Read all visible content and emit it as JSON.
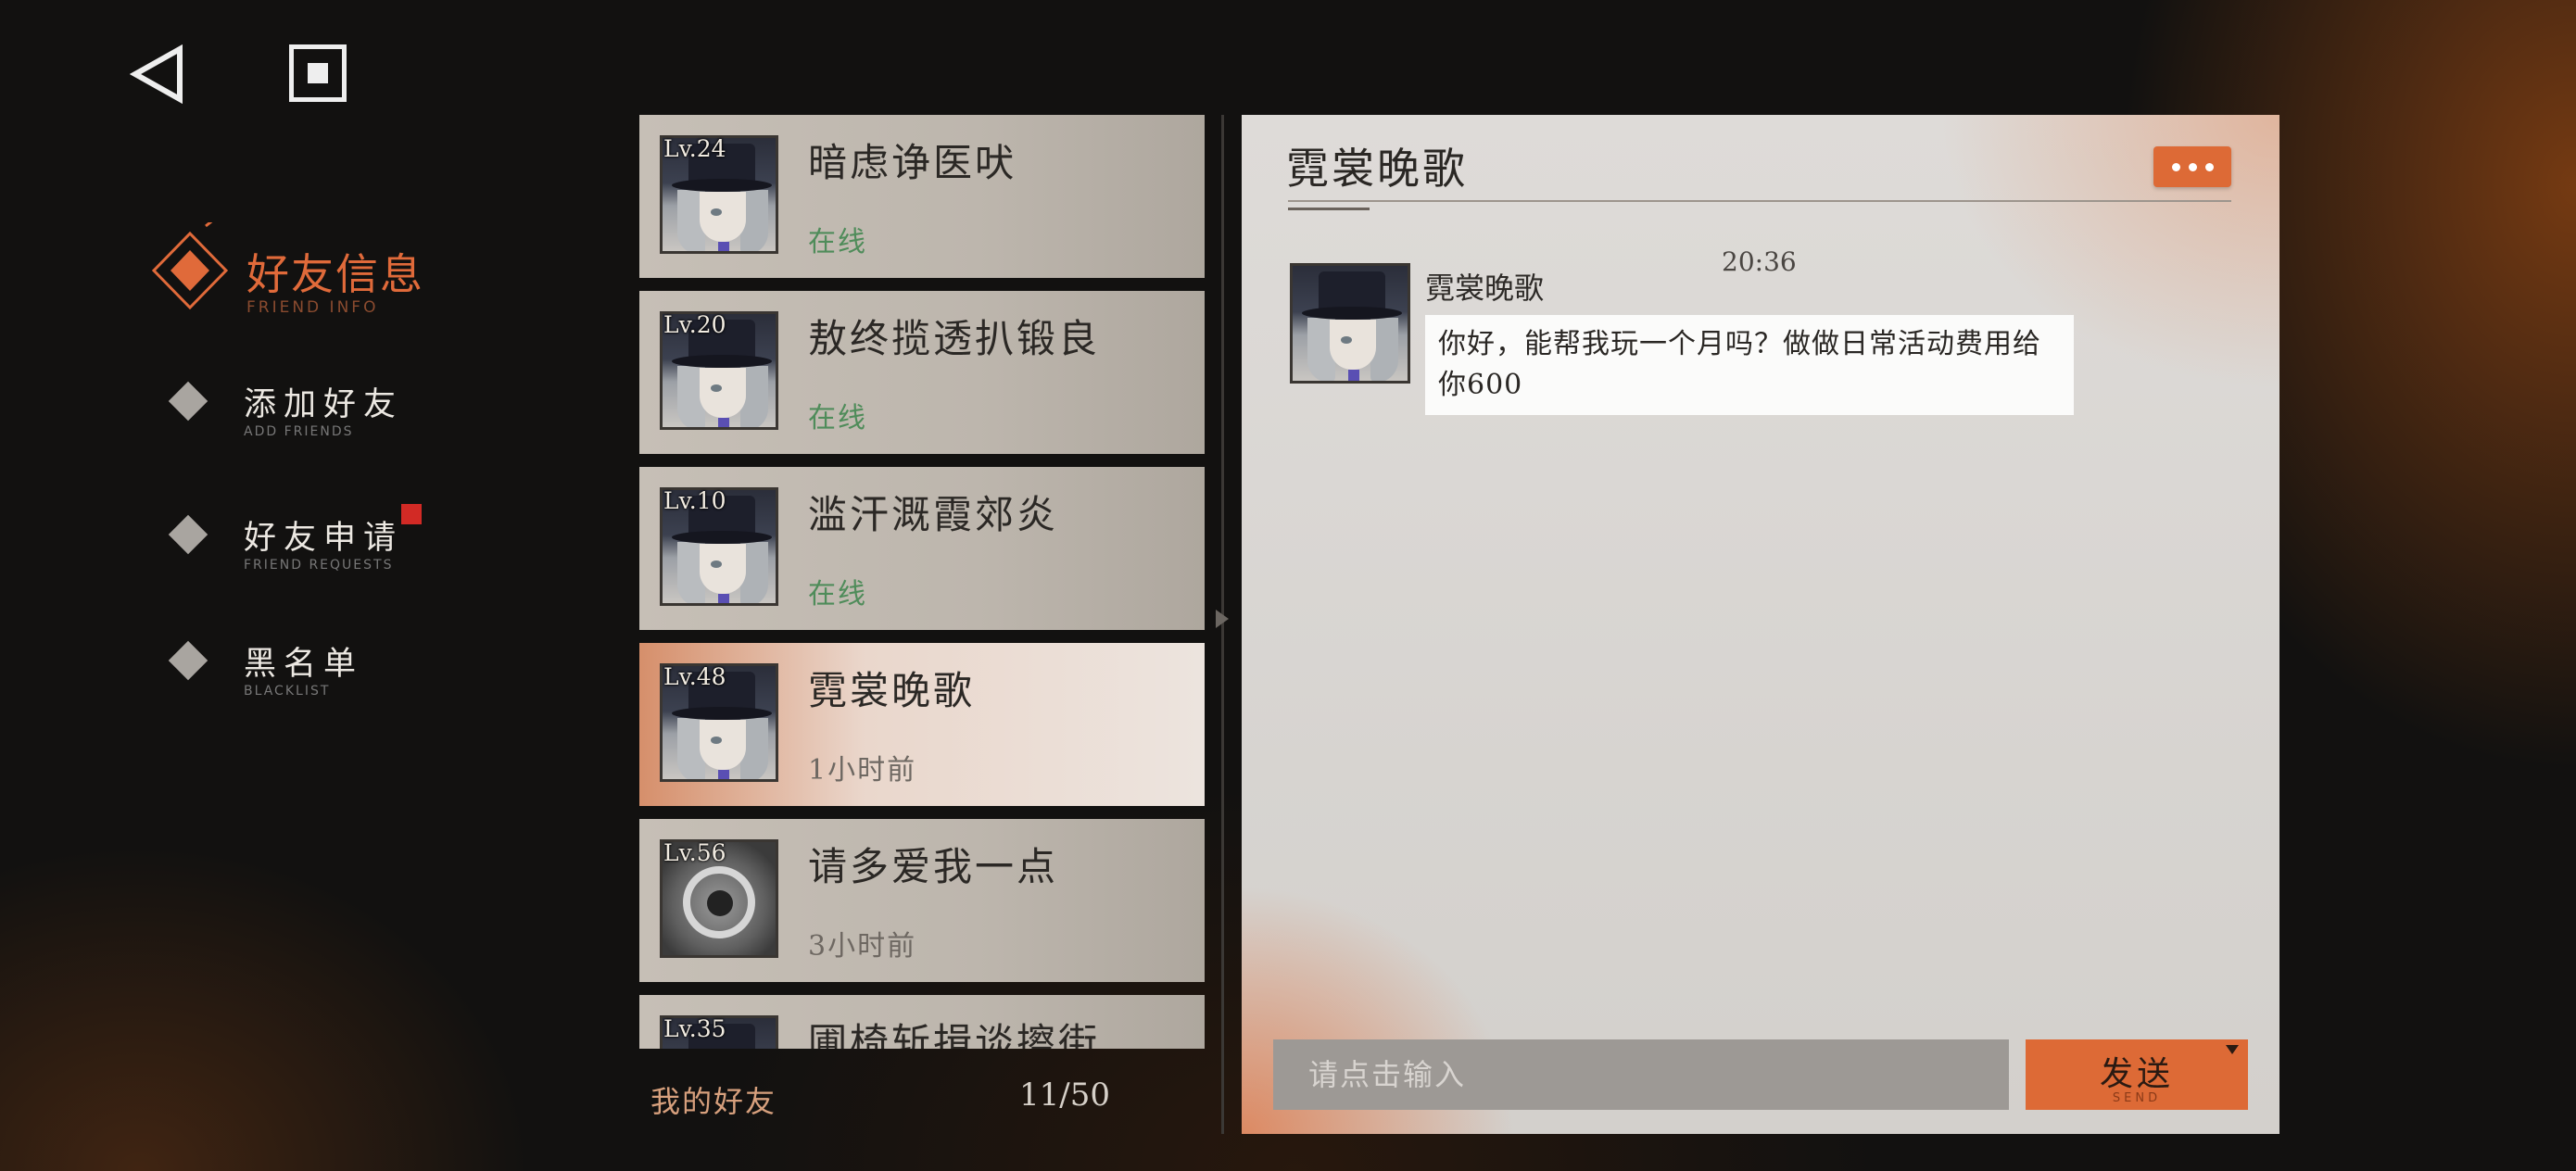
{
  "nav": {
    "back_icon": "back-triangle-icon",
    "home_icon": "home-square-icon"
  },
  "menu": {
    "title": "好友信息",
    "title_sub": "FRIEND INFO",
    "items": [
      {
        "label": "添加好友",
        "sub": "ADD FRIENDS"
      },
      {
        "label": "好友申请",
        "sub": "FRIEND REQUESTS",
        "has_badge": true
      },
      {
        "label": "黑名单",
        "sub": "BLACKLIST"
      }
    ]
  },
  "friends": [
    {
      "level": "Lv.24",
      "name": "暗虑诤医吠",
      "status": "在线",
      "online": true
    },
    {
      "level": "Lv.20",
      "name": "敖终揽透扒锻良",
      "status": "在线",
      "online": true
    },
    {
      "level": "Lv.10",
      "name": "滥汗溉霞郊炎",
      "status": "在线",
      "online": true
    },
    {
      "level": "Lv.48",
      "name": "霓裳晚歌",
      "status": "1小时前",
      "online": false,
      "selected": true
    },
    {
      "level": "Lv.56",
      "name": "请多爱我一点",
      "status": "3小时前",
      "online": false
    },
    {
      "level": "Lv.35",
      "name": "圃椅斩揖谈擦街",
      "status": "",
      "online": false
    }
  ],
  "friends_footer": {
    "label": "我的好友",
    "count": "11/50"
  },
  "chat": {
    "title": "霓裳晚歌",
    "time": "20:36",
    "messages": [
      {
        "sender": "霓裳晚歌",
        "text": "你好，能帮我玩一个月吗？做做日常活动费用给你600"
      }
    ],
    "input_placeholder": "请点击输入",
    "send_label": "发送",
    "send_sub": "SEND"
  },
  "colors": {
    "accent": "#dd6a36",
    "online": "#4f8c5a",
    "badge": "#d22a25"
  }
}
